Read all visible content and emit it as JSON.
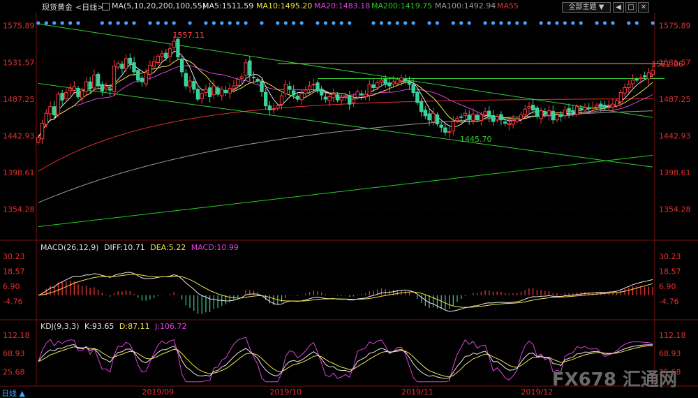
{
  "header": {
    "symbol": "现货黄金",
    "period": "<日线>",
    "ma_title": "MA(5,10,20,200,100,55)",
    "ma5": "MA5:1511.59",
    "ma10": "MA10:1495.20",
    "ma20": "MA20:1483.18",
    "ma200": "MA200:1419.75",
    "ma100": "MA100:1492.94",
    "ma55": "MA55",
    "theme_button": "全部主题",
    "colors": {
      "ma5": "#e8e8e8",
      "ma10": "#f2e34a",
      "ma20": "#e040e0",
      "ma200": "#22cc22",
      "ma100": "#9a9a9a",
      "ma55": "#e03030"
    }
  },
  "macd_header": {
    "title": "MACD(26,12,9)",
    "diff": "DIFF:10.71",
    "dea": "DEA:5.22",
    "macd": "MACD:10.99"
  },
  "kdj_header": {
    "title": "KDJ(9,3,3)",
    "k": "K:93.65",
    "d": "D:87.11",
    "j": "J:106.72"
  },
  "bottom": {
    "period_label": "日线"
  },
  "watermark": {
    "text": "FX678 汇通网"
  },
  "chart_data": [
    {
      "type": "candlestick",
      "title": "现货黄金 <日线>",
      "ylim": [
        1320,
        1590
      ],
      "price_ticks": [
        "1575.89",
        "1531.57",
        "1487.25",
        "1442.93",
        "1398.61",
        "1354.28"
      ],
      "price_tick_values": [
        1575.89,
        1531.57,
        1487.25,
        1442.93,
        1398.61,
        1354.28
      ],
      "x_labels": [
        "2019/09",
        "2019/10",
        "2019/11",
        "2019/12"
      ],
      "x_label_index": [
        30,
        62,
        95,
        125
      ],
      "annotations": [
        {
          "text": "1557.11",
          "value": 1557.11,
          "index": 33
        },
        {
          "text": "1445.70",
          "value": 1445.7,
          "index": 105
        },
        {
          "text": "1522.06",
          "value": 1522.06,
          "index": 153
        }
      ],
      "closes": [
        1441,
        1458,
        1470,
        1478,
        1468,
        1493,
        1486,
        1495,
        1500,
        1502,
        1490,
        1497,
        1508,
        1500,
        1516,
        1503,
        1497,
        1502,
        1498,
        1527,
        1530,
        1524,
        1536,
        1530,
        1520,
        1510,
        1508,
        1519,
        1528,
        1532,
        1539,
        1542,
        1537,
        1548,
        1557,
        1538,
        1520,
        1503,
        1509,
        1499,
        1487,
        1494,
        1499,
        1490,
        1503,
        1493,
        1499,
        1495,
        1500,
        1503,
        1511,
        1514,
        1531,
        1516,
        1513,
        1509,
        1496,
        1479,
        1474,
        1475,
        1479,
        1491,
        1505,
        1499,
        1492,
        1487,
        1494,
        1498,
        1503,
        1505,
        1497,
        1492,
        1487,
        1490,
        1493,
        1486,
        1489,
        1490,
        1481,
        1487,
        1496,
        1492,
        1493,
        1505,
        1501,
        1507,
        1510,
        1505,
        1503,
        1508,
        1511,
        1513,
        1509,
        1505,
        1495,
        1483,
        1472,
        1467,
        1462,
        1470,
        1457,
        1453,
        1447,
        1448,
        1460,
        1464,
        1465,
        1470,
        1463,
        1469,
        1462,
        1468,
        1472,
        1466,
        1460,
        1466,
        1462,
        1458,
        1458,
        1461,
        1463,
        1468,
        1475,
        1478,
        1474,
        1466,
        1473,
        1469,
        1473,
        1462,
        1468,
        1466,
        1474,
        1471,
        1471,
        1478,
        1475,
        1477,
        1476,
        1477,
        1480,
        1478,
        1477,
        1480,
        1481,
        1485,
        1495,
        1501,
        1505,
        1510,
        1510,
        1513,
        1514,
        1519,
        1522
      ]
    },
    {
      "type": "histogram+line",
      "title": "MACD(26,12,9)",
      "series_names": [
        "DIFF",
        "DEA",
        "MACD"
      ],
      "ylim": [
        -18,
        34
      ],
      "ticks": [
        "30.23",
        "18.57",
        "6.90",
        "-4.76"
      ],
      "tick_values": [
        30.23,
        18.57,
        6.9,
        -4.76
      ],
      "last": {
        "DIFF": 10.71,
        "DEA": 5.22,
        "MACD": 10.99
      }
    },
    {
      "type": "line",
      "title": "KDJ(9,3,3)",
      "series_names": [
        "K",
        "D",
        "J"
      ],
      "ylim": [
        0,
        125
      ],
      "ticks": [
        "112.18",
        "68.93",
        "25.68"
      ],
      "tick_values": [
        112.18,
        68.93,
        25.68
      ],
      "last": {
        "K": 93.65,
        "D": 87.11,
        "J": 106.72
      }
    }
  ]
}
